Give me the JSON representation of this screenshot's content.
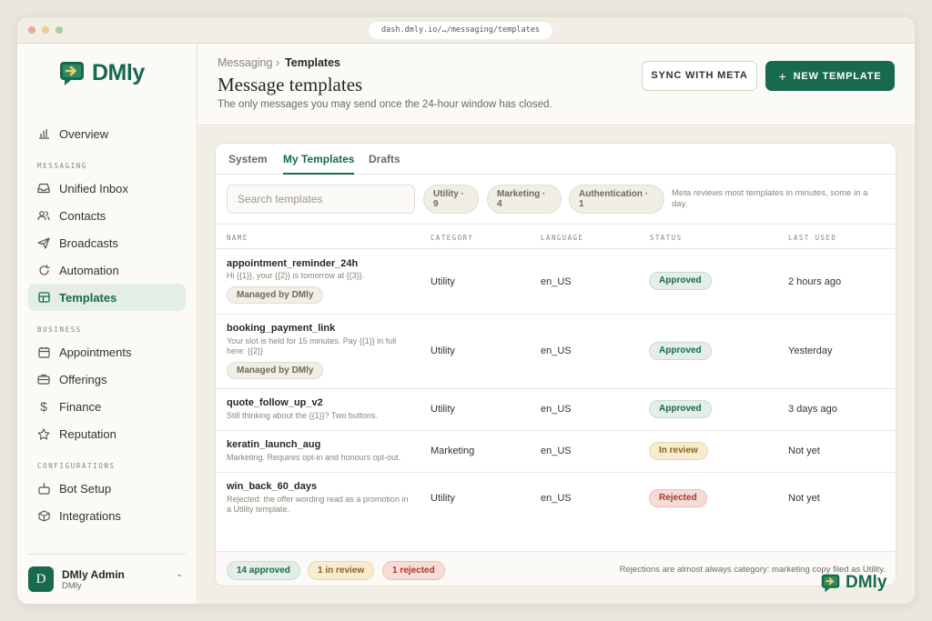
{
  "browser": {
    "url": "dash.dmly.io/…/messaging/templates"
  },
  "brand": {
    "name": "DMly",
    "accent": "#176a4e"
  },
  "sidebar": {
    "overview": "Overview",
    "sections": {
      "messaging": "MESSAGING",
      "business": "BUSINESS",
      "configurations": "CONFIGURATIONS"
    },
    "messaging_items": [
      "Unified Inbox",
      "Contacts",
      "Broadcasts",
      "Automation",
      "Templates"
    ],
    "business_items": [
      "Appointments",
      "Offerings",
      "Finance",
      "Reputation"
    ],
    "config_items": [
      "Bot Setup",
      "Integrations"
    ],
    "active": "Templates",
    "user": {
      "initial": "D",
      "name": "DMly Admin",
      "org": "DMly"
    }
  },
  "header": {
    "breadcrumb_parent": "Messaging ›",
    "breadcrumb_current": "Templates",
    "title": "Message templates",
    "subtitle": "The only messages you may send once the 24-hour window has closed.",
    "sync_label": "SYNC WITH META",
    "new_label": "NEW TEMPLATE"
  },
  "tabs": [
    "System",
    "My Templates",
    "Drafts"
  ],
  "active_tab": "My Templates",
  "search": {
    "placeholder": "Search templates"
  },
  "filters": {
    "chips": [
      {
        "label": "Utility ·",
        "count": "9"
      },
      {
        "label": "Marketing ·",
        "count": "4"
      },
      {
        "label": "Authentication ·",
        "count": "1"
      }
    ],
    "note": "Meta reviews most templates in minutes, some in a day."
  },
  "table": {
    "columns": [
      "NAME",
      "CATEGORY",
      "LANGUAGE",
      "STATUS",
      "LAST USED"
    ],
    "managed_label": "Managed by DMly",
    "rows": [
      {
        "name": "appointment_reminder_24h",
        "desc": "Hi {{1}}, your {{2}} is tomorrow at {{3}}.",
        "managed": true,
        "category": "Utility",
        "language": "en_US",
        "status": "Approved",
        "last_used": "2 hours ago"
      },
      {
        "name": "booking_payment_link",
        "desc": "Your slot is held for 15 minutes. Pay {{1}} in full here: {{2}}",
        "managed": true,
        "category": "Utility",
        "language": "en_US",
        "status": "Approved",
        "last_used": "Yesterday"
      },
      {
        "name": "quote_follow_up_v2",
        "desc": "Still thinking about the {{1}}? Two buttons.",
        "managed": false,
        "category": "Utility",
        "language": "en_US",
        "status": "Approved",
        "last_used": "3 days ago"
      },
      {
        "name": "keratin_launch_aug",
        "desc": "Marketing. Requires opt-in and honours opt-out.",
        "managed": false,
        "category": "Marketing",
        "language": "en_US",
        "status": "In review",
        "last_used": "Not yet"
      },
      {
        "name": "win_back_60_days",
        "desc": "Rejected: the offer wording read as a promotion in a Utility template.",
        "managed": false,
        "category": "Utility",
        "language": "en_US",
        "status": "Rejected",
        "last_used": "Not yet"
      }
    ]
  },
  "footer": {
    "approved": "14 approved",
    "in_review": "1 in review",
    "rejected": "1 rejected",
    "note": "Rejections are almost always category: marketing copy filed as Utility."
  },
  "colors": {
    "approved": "#176a4e",
    "review": "#8a6318",
    "rejected": "#a33a2c",
    "mac_red": "#e8a89c",
    "mac_yellow": "#e8cf92",
    "mac_green": "#a9cfa7"
  }
}
